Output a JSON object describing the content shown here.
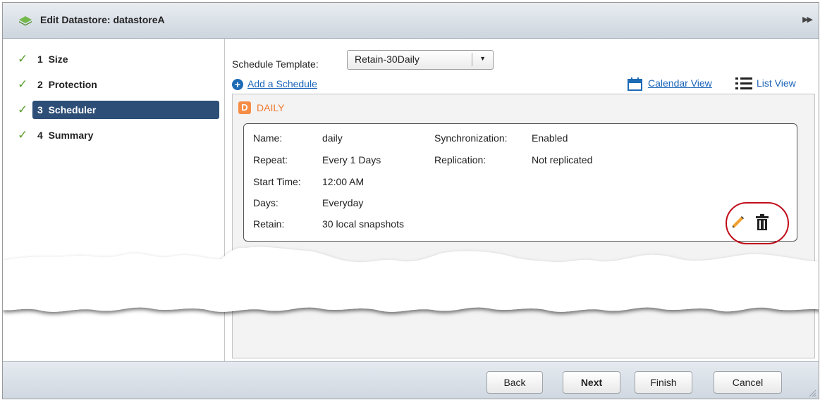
{
  "window": {
    "title": "Edit Datastore: datastoreA"
  },
  "nav": {
    "items": [
      {
        "number": "1",
        "label": "Size",
        "done": true,
        "active": false
      },
      {
        "number": "2",
        "label": "Protection",
        "done": true,
        "active": false
      },
      {
        "number": "3",
        "label": "Scheduler",
        "done": true,
        "active": true
      },
      {
        "number": "4",
        "label": "Summary",
        "done": true,
        "active": false
      }
    ]
  },
  "scheduler": {
    "template_label": "Schedule Template:",
    "template_value": "Retain-30Daily",
    "add_schedule": "Add a Schedule",
    "calendar_view": "Calendar View",
    "list_view": "List View",
    "schedule": {
      "badge": "D",
      "label": "DAILY",
      "fields": {
        "name_key": "Name:",
        "name_val": "daily",
        "repeat_key": "Repeat:",
        "repeat_val": "Every 1 Days",
        "start_key": "Start Time:",
        "start_val": "12:00 AM",
        "days_key": "Days:",
        "days_val": "Everyday",
        "retain_key": "Retain:",
        "retain_val": "30  local snapshots",
        "sync_key": "Synchronization:",
        "sync_val": "Enabled",
        "repl_key": "Replication:",
        "repl_val": "Not replicated"
      }
    }
  },
  "footer": {
    "back": "Back",
    "next": "Next",
    "finish": "Finish",
    "cancel": "Cancel"
  },
  "colors": {
    "nav_active_bg": "#2d4e77",
    "check": "#5c9f2b",
    "link": "#1a64b8",
    "daily_accent": "#f58d46",
    "highlight": "#c00d1a"
  }
}
